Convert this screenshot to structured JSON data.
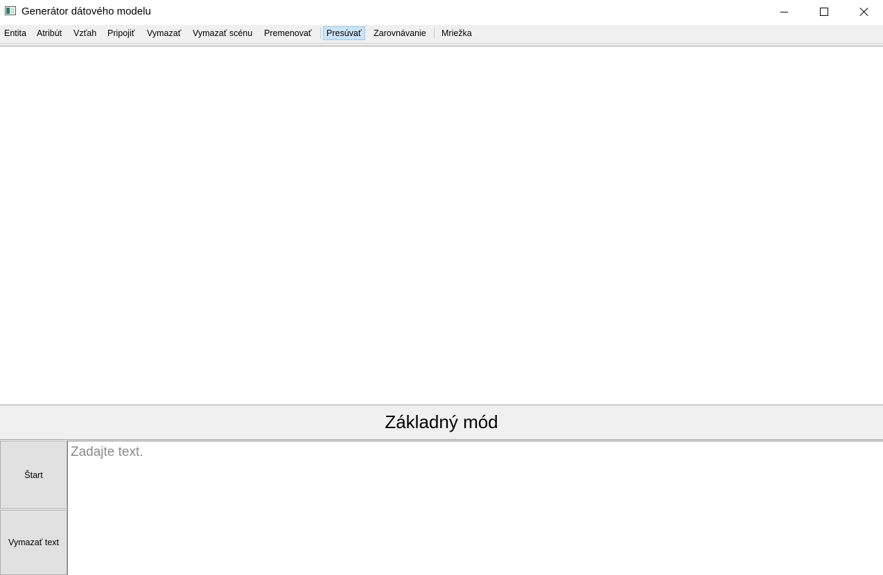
{
  "window": {
    "title": "Generátor dátového modelu",
    "app_icon": "app-window-icon",
    "controls": [
      "minimize-icon",
      "maximize-icon",
      "close-icon"
    ]
  },
  "toolbar": {
    "items": [
      {
        "label": "Entita"
      },
      {
        "label": "Atribút"
      },
      {
        "label": "Vzťah"
      },
      {
        "label": "Pripojiť"
      },
      {
        "label": "Vymazať"
      },
      {
        "label": "Vymazať scénu"
      },
      {
        "label": "Premenovať"
      },
      {
        "label": "Presúvať",
        "active": true
      },
      {
        "label": "Zarovnávanie"
      },
      {
        "label": "Mriežka"
      }
    ]
  },
  "mode": {
    "label": "Základný mód"
  },
  "bottom": {
    "start_label": "Štart",
    "clear_label": "Vymazať text",
    "input_placeholder": "Zadajte text.",
    "input_value": ""
  },
  "colors": {
    "active_tool_bg": "#cce4f7",
    "active_tool_border": "#99c9ef",
    "toolbar_bg": "#f0f0f0",
    "button_bg": "#e1e1e1"
  }
}
